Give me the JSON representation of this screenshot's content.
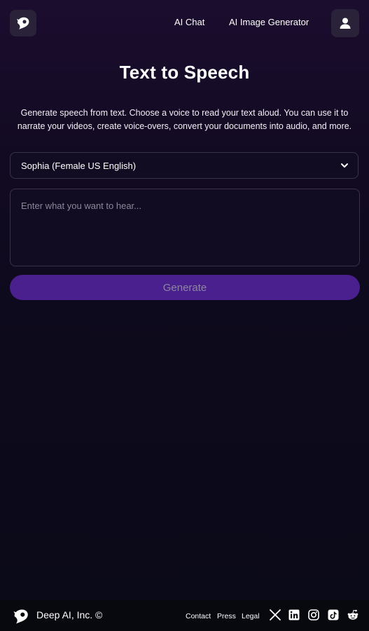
{
  "header": {
    "nav": [
      {
        "label": "AI Chat"
      },
      {
        "label": "AI Image Generator"
      }
    ],
    "logo_icon": "deepai-logo-icon",
    "user_icon": "user-icon"
  },
  "main": {
    "title": "Text to Speech",
    "description": "Generate speech from text. Choose a voice to read your text aloud. You can use it to narrate your videos, create voice-overs, convert your documents into audio, and more.",
    "voice_select": {
      "value": "Sophia (Female US English)",
      "icon": "chevron-down-icon"
    },
    "text_input": {
      "value": "",
      "placeholder": "Enter what you want to hear..."
    },
    "generate_label": "Generate"
  },
  "footer": {
    "company": "Deep AI, Inc. ©",
    "links": [
      {
        "label": "Contact"
      },
      {
        "label": "Press"
      },
      {
        "label": "Legal"
      }
    ],
    "social_icons": [
      "x-icon",
      "linkedin-icon",
      "instagram-icon",
      "tiktok-icon",
      "reddit-icon"
    ]
  },
  "colors": {
    "accent": "#4a1f8e",
    "background_top": "#1b0d2e",
    "background_bottom": "#0b0a18",
    "button_text_disabled": "#8f86a3"
  }
}
